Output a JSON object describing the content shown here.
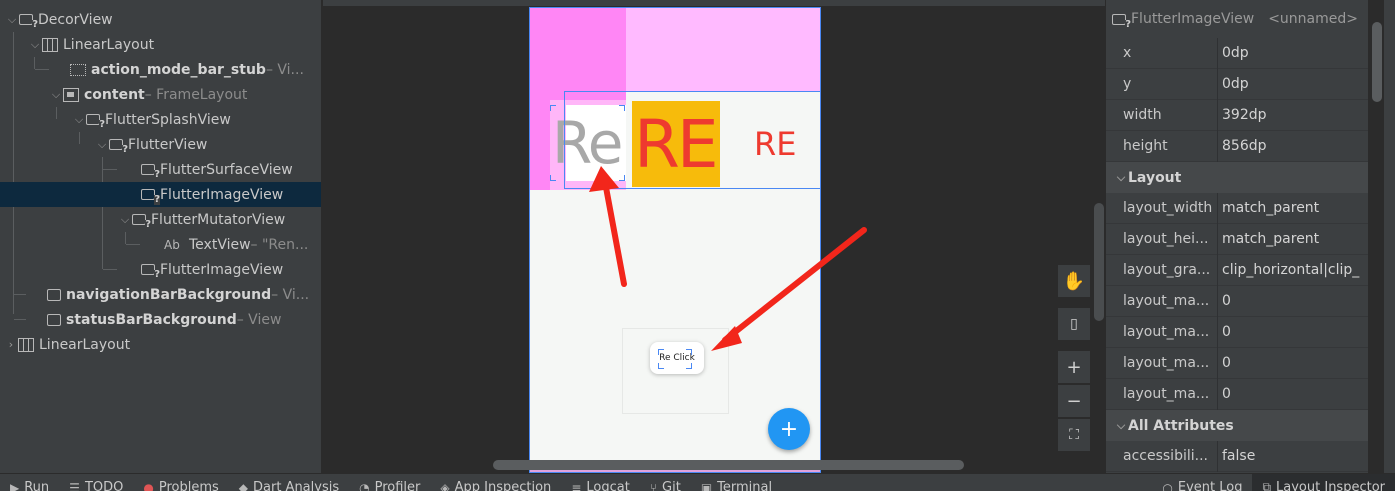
{
  "tree": {
    "nodes": [
      {
        "name": "DecorView",
        "sub": ""
      },
      {
        "name": "LinearLayout",
        "sub": ""
      },
      {
        "name": "action_mode_bar_stub",
        "sub": " – Vi..."
      },
      {
        "name": "content",
        "sub": " – FrameLayout"
      },
      {
        "name": "FlutterSplashView",
        "sub": ""
      },
      {
        "name": "FlutterView",
        "sub": ""
      },
      {
        "name": "FlutterSurfaceView",
        "sub": ""
      },
      {
        "name": "FlutterImageView",
        "sub": ""
      },
      {
        "name": "FlutterMutatorView",
        "sub": ""
      },
      {
        "name": "TextView",
        "sub": " – \"Ren..."
      },
      {
        "name": "FlutterImageView",
        "sub": ""
      },
      {
        "name": "navigationBarBackground",
        "sub": " – Vi..."
      },
      {
        "name": "statusBarBackground",
        "sub": " – View"
      },
      {
        "name": "LinearLayout",
        "sub": ""
      }
    ],
    "textview_icon": "Ab"
  },
  "device": {
    "re_gray": "Re",
    "re_big": "RE",
    "re_small": "RE",
    "button_label": "Re Click",
    "fab_label": "+"
  },
  "attributes": {
    "header_title": "FlutterImageView",
    "header_id": "<unnamed>",
    "basic": [
      {
        "k": "x",
        "v": "0dp"
      },
      {
        "k": "y",
        "v": "0dp"
      },
      {
        "k": "width",
        "v": "392dp"
      },
      {
        "k": "height",
        "v": "856dp"
      }
    ],
    "layout_section": "Layout",
    "layout": [
      {
        "k": "layout_width",
        "v": "match_parent"
      },
      {
        "k": "layout_hei...",
        "v": "match_parent"
      },
      {
        "k": "layout_gra...",
        "v": "clip_horizontal|clip_"
      },
      {
        "k": "layout_ma...",
        "v": "0"
      },
      {
        "k": "layout_ma...",
        "v": "0"
      },
      {
        "k": "layout_ma...",
        "v": "0"
      },
      {
        "k": "layout_ma...",
        "v": "0"
      }
    ],
    "all_section": "All Attributes",
    "all": [
      {
        "k": "accessibili...",
        "v": "false"
      }
    ]
  },
  "bottom_tabs": [
    {
      "label": "Run",
      "icon": "run-icon"
    },
    {
      "label": "TODO",
      "icon": "todo-icon"
    },
    {
      "label": "Problems",
      "icon": "problems-icon"
    },
    {
      "label": "Dart Analysis",
      "icon": "dart-analysis-icon"
    },
    {
      "label": "Profiler",
      "icon": "profiler-icon"
    },
    {
      "label": "App Inspection",
      "icon": "app-inspection-icon"
    },
    {
      "label": "Logcat",
      "icon": "logcat-icon"
    },
    {
      "label": "Git",
      "icon": "git-icon"
    },
    {
      "label": "Terminal",
      "icon": "terminal-icon"
    }
  ],
  "bottom_right_tabs": [
    {
      "label": "Event Log",
      "icon": "event-log-icon"
    },
    {
      "label": "Layout Inspector",
      "icon": "layout-inspector-icon"
    }
  ],
  "colors": {
    "accent": "#4a88f3",
    "fab": "#2196f3",
    "arrow": "#f2261b",
    "orange": "#f7bb0b",
    "red_text": "#ee3a2f"
  }
}
